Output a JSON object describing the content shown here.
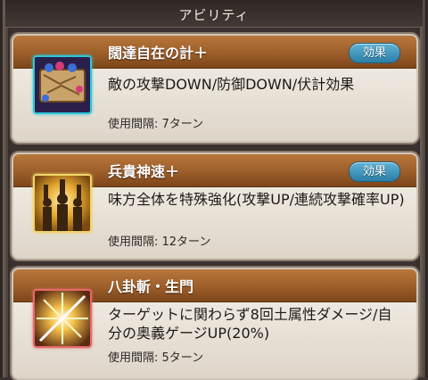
{
  "header": {
    "title": "アビリティ"
  },
  "abilities": [
    {
      "name": "闊達自在の計＋",
      "effect_label": "効果",
      "description": "敵の攻撃DOWN/防御DOWN/伏計効果",
      "cooldown": "使用間隔: 7ターン",
      "icon": "strategy-map-icon",
      "icon_frame_color": "#2ec7d9"
    },
    {
      "name": "兵貴神速＋",
      "effect_label": "効果",
      "description": "味方全体を特殊強化(攻撃UP/連続攻撃確率UP)",
      "cooldown": "使用間隔: 12ターン",
      "icon": "raised-fists-icon",
      "icon_frame_color": "#f1d36a"
    },
    {
      "name": "八卦斬・生門",
      "effect_label": "",
      "description": "ターゲットに関わらず8回土属性ダメージ/自分の奥義ゲージUP(20%)",
      "cooldown": "使用間隔: 5ターン",
      "icon": "burst-slash-icon",
      "icon_frame_color": "#e56a6a"
    }
  ]
}
